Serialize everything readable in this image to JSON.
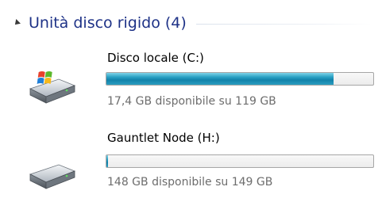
{
  "group": {
    "title": "Unità disco rigido (4)"
  },
  "drives": [
    {
      "name": "Disco locale (C:)",
      "space": "17,4 GB disponibile su 119 GB",
      "used_fraction": 0.85,
      "icon": "system-hard-drive-icon",
      "bar_color": "#1a8fb6"
    },
    {
      "name": "Gauntlet Node (H:)",
      "space": "148 GB disponibile su 149 GB",
      "used_fraction": 0.007,
      "icon": "hard-drive-icon",
      "bar_color": "#1a8fb6"
    }
  ]
}
